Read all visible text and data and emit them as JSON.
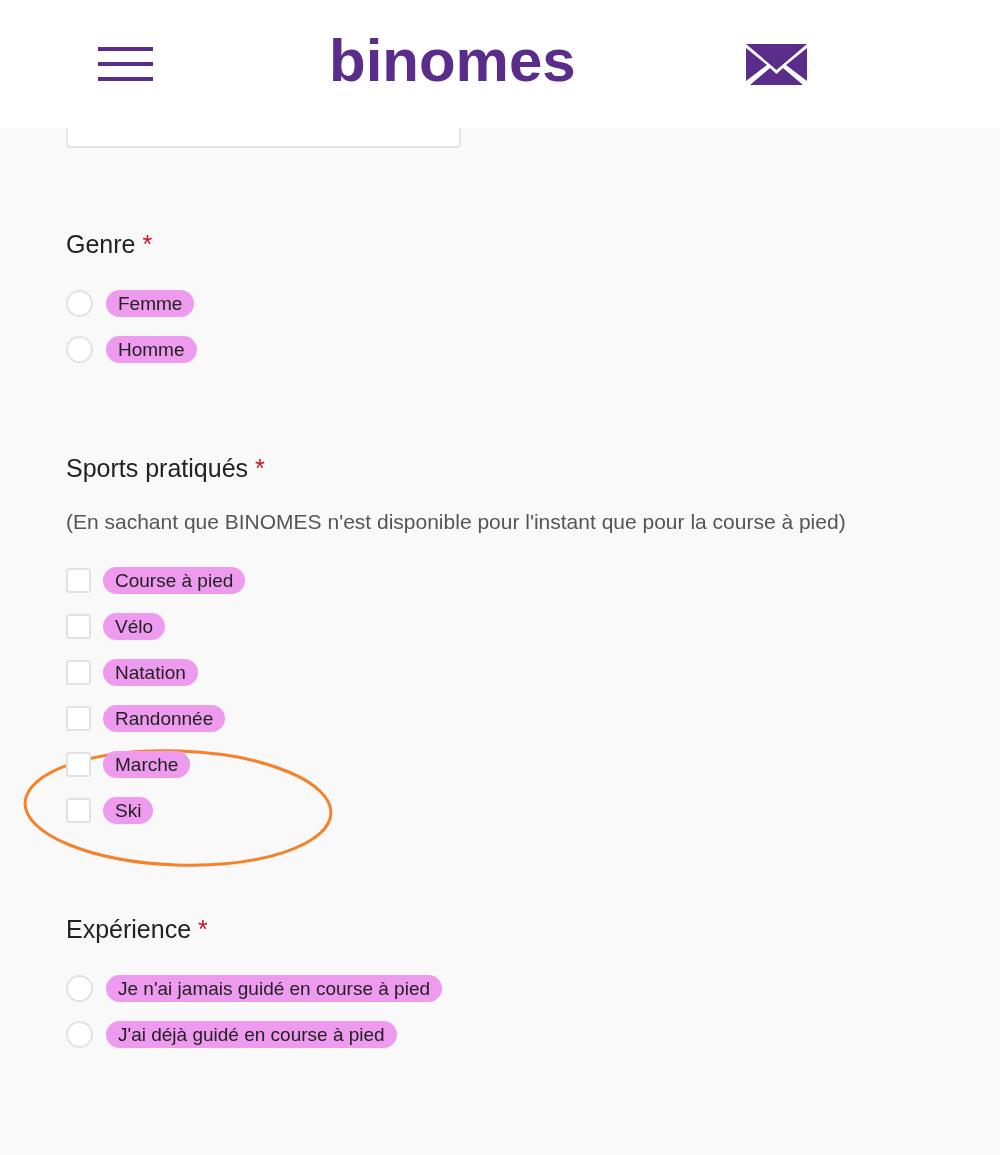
{
  "header": {
    "logo": "binomes"
  },
  "sections": [
    {
      "kind": "radio",
      "title": "Genre",
      "required_mark": "*",
      "options": [
        {
          "label": "Femme",
          "selected": false
        },
        {
          "label": "Homme",
          "selected": false
        }
      ]
    },
    {
      "kind": "checkbox",
      "title": "Sports pratiqués",
      "required_mark": "*",
      "note": "(En sachant que BINOMES n'est disponible pour l'instant que pour la course à pied)",
      "options": [
        {
          "label": "Course à pied",
          "checked": false
        },
        {
          "label": "Vélo",
          "checked": false
        },
        {
          "label": "Natation",
          "checked": false
        },
        {
          "label": "Randonnée",
          "checked": false
        },
        {
          "label": "Marche",
          "checked": false
        },
        {
          "label": "Ski",
          "checked": false
        }
      ]
    },
    {
      "kind": "radio",
      "title": "Expérience",
      "required_mark": "*",
      "options": [
        {
          "label": "Je n'ai jamais guidé en course à pied",
          "selected": false
        },
        {
          "label": "J'ai déjà guidé en course à pied",
          "selected": false
        }
      ]
    }
  ]
}
